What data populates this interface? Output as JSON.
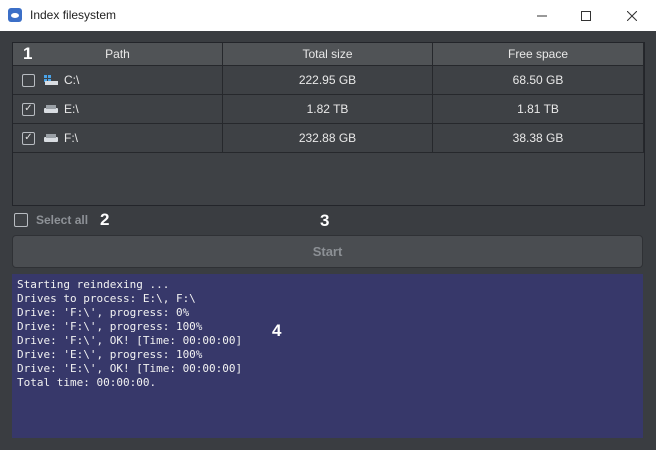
{
  "window": {
    "title": "Index filesystem",
    "controls": [
      "minimize",
      "maximize",
      "close"
    ]
  },
  "table": {
    "headers": {
      "path": "Path",
      "total": "Total size",
      "free": "Free space"
    },
    "rows": [
      {
        "checked": false,
        "drive_icon": "system-drive-icon",
        "path": "C:\\",
        "total": "222.95 GB",
        "free": "68.50 GB"
      },
      {
        "checked": true,
        "drive_icon": "drive-icon",
        "path": "E:\\",
        "total": "1.82 TB",
        "free": "1.81 TB"
      },
      {
        "checked": true,
        "drive_icon": "drive-icon",
        "path": "F:\\",
        "total": "232.88 GB",
        "free": "38.38 GB"
      }
    ]
  },
  "select_all": {
    "label": "Select all",
    "checked": false
  },
  "start_button": {
    "label": "Start",
    "enabled": false
  },
  "log": {
    "lines": [
      "Starting reindexing ...",
      "Drives to process: E:\\, F:\\",
      "Drive: 'F:\\', progress: 0%",
      "Drive: 'F:\\', progress: 100%",
      "Drive: 'F:\\', OK! [Time: 00:00:00]",
      "Drive: 'E:\\', progress: 100%",
      "Drive: 'E:\\', OK! [Time: 00:00:00]",
      "Total time: 00:00:00."
    ]
  },
  "annotations": [
    "1",
    "2",
    "3",
    "4"
  ],
  "colors": {
    "background": "#3a3d41",
    "table_header": "#505356",
    "log_background": "#37386a",
    "text": "#e9e9e9"
  }
}
